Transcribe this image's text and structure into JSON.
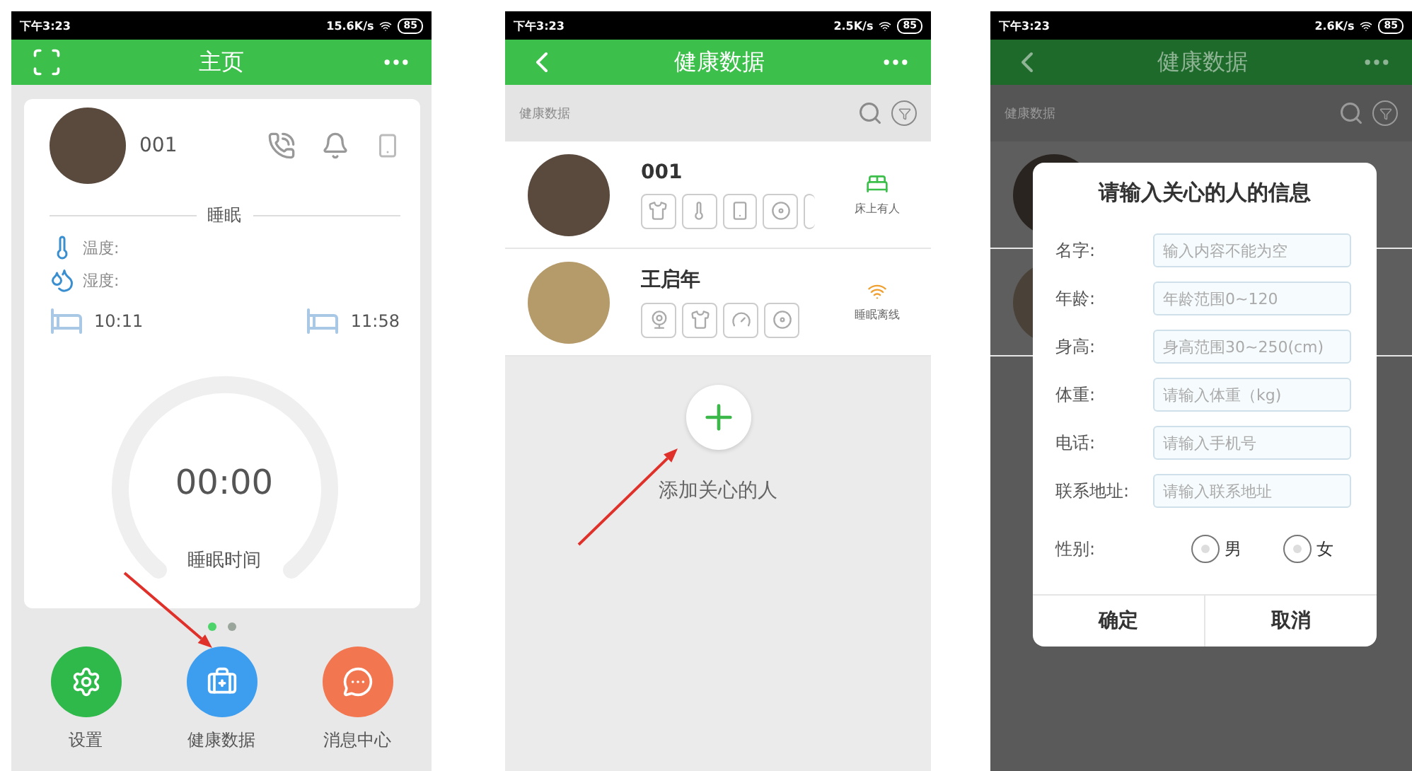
{
  "home": {
    "status_bar": {
      "time": "下午3:23",
      "speed": "15.6K/s",
      "battery": "85"
    },
    "header": {
      "title": "主页"
    },
    "card": {
      "name": "001",
      "section": "睡眠",
      "readings": [
        {
          "kind": "temperature",
          "label": "温度:"
        },
        {
          "kind": "humidity",
          "label": "湿度:"
        }
      ],
      "bed_in": "10:11",
      "bed_out": "11:58",
      "timer": "00:00",
      "timer_label": "睡眠时间"
    },
    "pager": [
      {
        "selected": true
      },
      {
        "selected": false
      }
    ],
    "nav": [
      {
        "kind": "settings",
        "label": "设置",
        "color": "#2fb94a"
      },
      {
        "kind": "health",
        "label": "健康数据",
        "color": "#3d9ef0"
      },
      {
        "kind": "messages",
        "label": "消息中心",
        "color": "#f27650"
      }
    ]
  },
  "health": {
    "status_bar": {
      "time": "下午3:23",
      "speed": "2.5K/s",
      "battery": "85"
    },
    "header": {
      "title": "健康数据"
    },
    "breadcrumb": "健康数据",
    "people": [
      {
        "name": "001",
        "status": "床上有人",
        "kind": "in_bed",
        "devices": [
          {
            "kind": "vest"
          },
          {
            "kind": "thermometer"
          },
          {
            "kind": "phone"
          },
          {
            "kind": "pad"
          },
          {
            "kind": "cut"
          }
        ]
      },
      {
        "name": "王启年",
        "status": "睡眠离线",
        "kind": "offline",
        "devices": [
          {
            "kind": "camera"
          },
          {
            "kind": "vest"
          },
          {
            "kind": "meter"
          },
          {
            "kind": "pad"
          }
        ]
      }
    ],
    "add_label": "添加关心的人"
  },
  "dialog_screen": {
    "status_bar": {
      "time": "下午3:23",
      "speed": "2.6K/s",
      "battery": "85"
    },
    "header": {
      "title": "健康数据"
    },
    "breadcrumb": "健康数据",
    "dialog": {
      "title": "请输入关心的人的信息",
      "fields": [
        {
          "label": "名字:",
          "placeholder": "输入内容不能为空"
        },
        {
          "label": "年龄:",
          "placeholder": "年龄范围0~120"
        },
        {
          "label": "身高:",
          "placeholder": "身高范围30~250(cm)"
        },
        {
          "label": "体重:",
          "placeholder": "请输入体重（kg)"
        },
        {
          "label": "电话:",
          "placeholder": "请输入手机号"
        },
        {
          "label": "联系地址:",
          "placeholder": "请输入联系地址"
        }
      ],
      "gender_label": "性别:",
      "gender_options": [
        {
          "label": "男",
          "selected": false
        },
        {
          "label": "女",
          "selected": false
        }
      ],
      "buttons": [
        "确定",
        "取消"
      ]
    }
  }
}
